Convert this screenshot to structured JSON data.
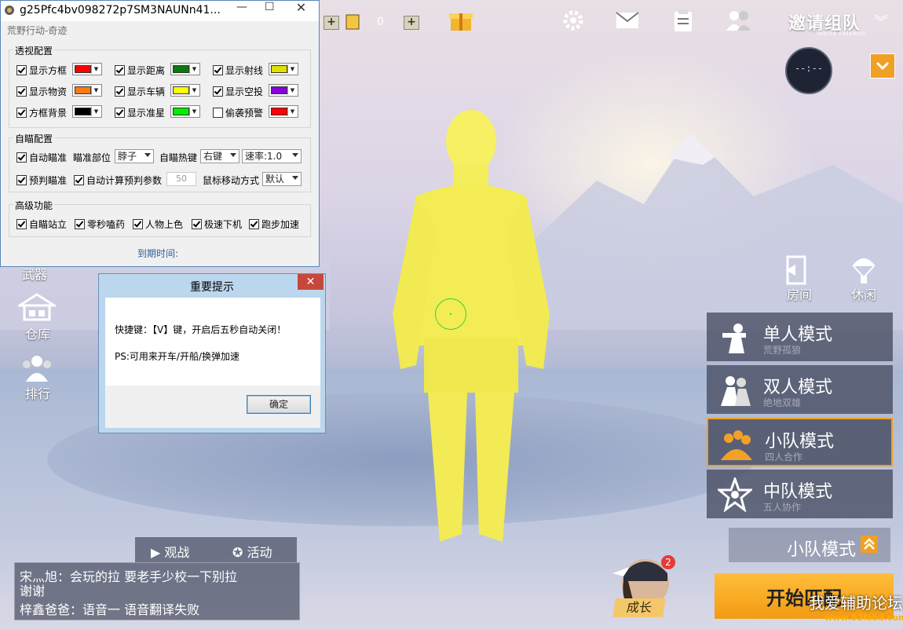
{
  "game": {
    "coin_count": "0",
    "invite_title": "邀请组队",
    "invite_subtitle": "INVITE FRIENDS",
    "clock_text": "--:--",
    "side_left": [
      {
        "label": "仓库",
        "icon": "warehouse-icon"
      },
      {
        "label": "排行",
        "icon": "ranking-icon"
      }
    ],
    "side_left_partial": "武器",
    "side_right": [
      {
        "label": "房间",
        "icon": "door-icon"
      },
      {
        "label": "休闲",
        "icon": "parachute-icon"
      }
    ],
    "modes": [
      {
        "title": "单人模式",
        "subtitle": "荒野孤狼",
        "active": false
      },
      {
        "title": "双人模式",
        "subtitle": "绝地双雄",
        "active": false
      },
      {
        "title": "小队模式",
        "subtitle": "四人合作",
        "active": true
      },
      {
        "title": "中队模式",
        "subtitle": "五人协作",
        "active": false
      }
    ],
    "team_selector": "小队模式",
    "start_button": "开始匹配",
    "growth_label": "成长",
    "growth_badge": "2",
    "chat_tabs": [
      "观战",
      "活动"
    ],
    "chat_lines": [
      "宋灬旭：会玩的拉 要老手少校一下别拉",
      "谢谢",
      "梓鑫爸爸：语音一 语音翻译失败"
    ],
    "watermark": "我爱辅助论坛",
    "watermark_url": "www.52fzba.com",
    "colors": {
      "accent": "#f0a020",
      "character_glow": "#f6f05a"
    }
  },
  "tool": {
    "window_title": "g25Pfc4bv098272p7SM3NAUNn41...",
    "subtitle": "荒野行动-奇迹",
    "min_glyph": "—",
    "max_glyph": "☐",
    "close_glyph": "✕",
    "group_esp": "透视配置",
    "esp_rows": [
      [
        {
          "label": "显示方框",
          "checked": true,
          "color": "#ff0000"
        },
        {
          "label": "显示距离",
          "checked": true,
          "color": "#0a7a0a"
        },
        {
          "label": "显示射线",
          "checked": true,
          "color": "#e0e000"
        }
      ],
      [
        {
          "label": "显示物资",
          "checked": true,
          "color": "#ff7a10"
        },
        {
          "label": "显示车辆",
          "checked": true,
          "color": "#ffff00"
        },
        {
          "label": "显示空投",
          "checked": true,
          "color": "#8800dd"
        }
      ],
      [
        {
          "label": "方框背景",
          "checked": true,
          "color": "#000000"
        },
        {
          "label": "显示准星",
          "checked": true,
          "color": "#00ee00"
        },
        {
          "label": "偷袭预警",
          "checked": false,
          "color": "#ff0000"
        }
      ]
    ],
    "group_aim": "自瞄配置",
    "aim": {
      "auto_aim": "自动瞄准",
      "aim_part_label": "瞄准部位",
      "aim_part_value": "脖子",
      "hotkey_label": "自瞄热键",
      "hotkey_value": "右键",
      "speed_value": "速率:1.0",
      "predict": "预判瞄准",
      "auto_calc": "自动计算预判参数",
      "param_value": "50",
      "mouse_mode_label": "鼠标移动方式",
      "mouse_mode_value": "默认"
    },
    "group_adv": "高级功能",
    "adv": [
      "自瞄站立",
      "零秒嗑药",
      "人物上色",
      "极速下机",
      "跑步加速"
    ],
    "expire_label": "到期时间:"
  },
  "dialog": {
    "title": "重要提示",
    "line1": "快捷键：【V】键，开启后五秒自动关闭！",
    "line2": "PS:可用来开车/开船/换弹加速",
    "ok_label": "确定",
    "close_glyph": "✕"
  }
}
